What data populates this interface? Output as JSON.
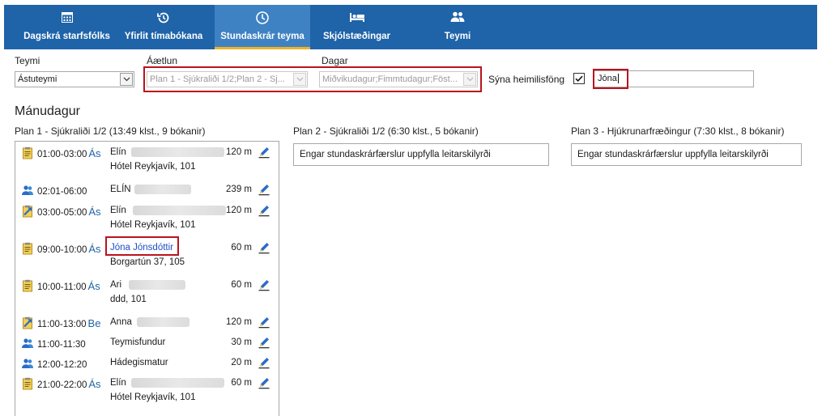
{
  "nav": {
    "tabs": [
      {
        "label": "Dagskrá starfsfólks",
        "icon": "calendar-icon"
      },
      {
        "label": "Yfirlit tímabókana",
        "icon": "history-icon"
      },
      {
        "label": "Stundaskrár teyma",
        "icon": "clock-icon",
        "active": true
      },
      {
        "label": "Skjólstæðingar",
        "icon": "bed-icon"
      },
      {
        "label": "Teymi",
        "icon": "people-icon"
      }
    ]
  },
  "filters": {
    "team_label": "Teymi",
    "team_value": "Ástuteymi",
    "plan_label": "Áætlun",
    "plan_value": "Plan 1 - Sjúkraliði 1/2;Plan 2 - Sj...",
    "days_label": "Dagar",
    "days_value": "Miðvikudagur;Fimmtudagur;Föst...",
    "show_addresses_label": "Sýna heimilisföng",
    "show_addresses_checked": true,
    "search_value": "Jóna"
  },
  "day": {
    "title": "Mánudagur",
    "plans": [
      {
        "header": "Plan 1 - Sjúkraliði 1/2 (13:49 klst., 9 bókanir)"
      },
      {
        "header": "Plan 2 - Sjúkraliði 1/2 (6:30 klst., 5 bókanir)",
        "empty_text": "Engar stundaskrárfærslur uppfylla leitarskilyrði"
      },
      {
        "header": "Plan 3 - Hjúkrunarfræðingur (7:30 klst., 8 bókanir)",
        "empty_text": "Engar stundaskrárfærslur uppfylla leitarskilyrði"
      }
    ],
    "rows": [
      {
        "icon": "clipboard-icon",
        "time": "01:00-03:00",
        "code": "Ás",
        "name": "Elín",
        "duration": "120 m",
        "address": "Hótel Reykjavík, 101"
      },
      {
        "icon": "group-icon",
        "time": "02:01-06:00",
        "code": "",
        "name": "ELÍN",
        "duration": "239 m",
        "address": ""
      },
      {
        "icon": "transfer-icon",
        "time": "03:00-05:00",
        "code": "Ás",
        "name": "Elín",
        "duration": "120 m",
        "address": "Hótel Reykjavík, 101"
      },
      {
        "icon": "clipboard-icon",
        "time": "09:00-10:00",
        "code": "Ás",
        "name": "Jóna Jónsdóttir",
        "duration": "60 m",
        "address": "Borgartún 37, 105"
      },
      {
        "icon": "clipboard-icon",
        "time": "10:00-11:00",
        "code": "Ás",
        "name": "Ari",
        "duration": "60 m",
        "address": "ddd, 101"
      },
      {
        "icon": "transfer-icon",
        "time": "11:00-13:00",
        "code": "Be",
        "name": "Anna",
        "duration": "120 m",
        "address": ""
      },
      {
        "icon": "group-icon",
        "time": "11:00-11:30",
        "code": "",
        "name": "Teymisfundur",
        "duration": "30 m",
        "address": ""
      },
      {
        "icon": "group-icon",
        "time": "12:00-12:20",
        "code": "",
        "name": "Hádegismatur",
        "duration": "20 m",
        "address": ""
      },
      {
        "icon": "clipboard-icon",
        "time": "21:00-22:00",
        "code": "Ás",
        "name": "Elín",
        "duration": "60 m",
        "address": "Hótel Reykjavík, 101"
      }
    ]
  },
  "colors": {
    "ribbon": "#1f63a8",
    "active_tab": "#3f82c3",
    "accent_underline": "#f0b323",
    "highlight": "#b9141e"
  }
}
